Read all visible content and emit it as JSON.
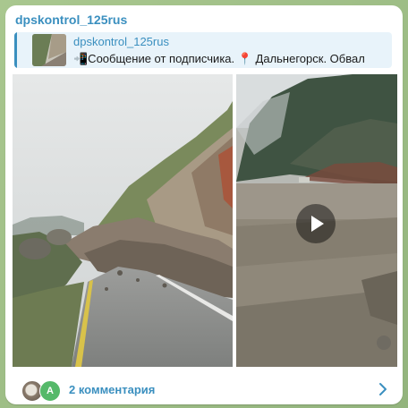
{
  "post": {
    "channel_name": "dpskontrol_125rus",
    "reply": {
      "title": "dpskontrol_125rus",
      "text": "📲Сообщение от подписчика. 📍 Дальнегорск. Обвал"
    },
    "comments_label": "2 комментария",
    "avatar_letter": "A"
  },
  "icons": {
    "play": "play-icon",
    "chevron": "chevron-right-icon"
  },
  "colors": {
    "accent": "#3a8fbf",
    "bubble": "#ffffff",
    "background": "#9fbe8a"
  }
}
